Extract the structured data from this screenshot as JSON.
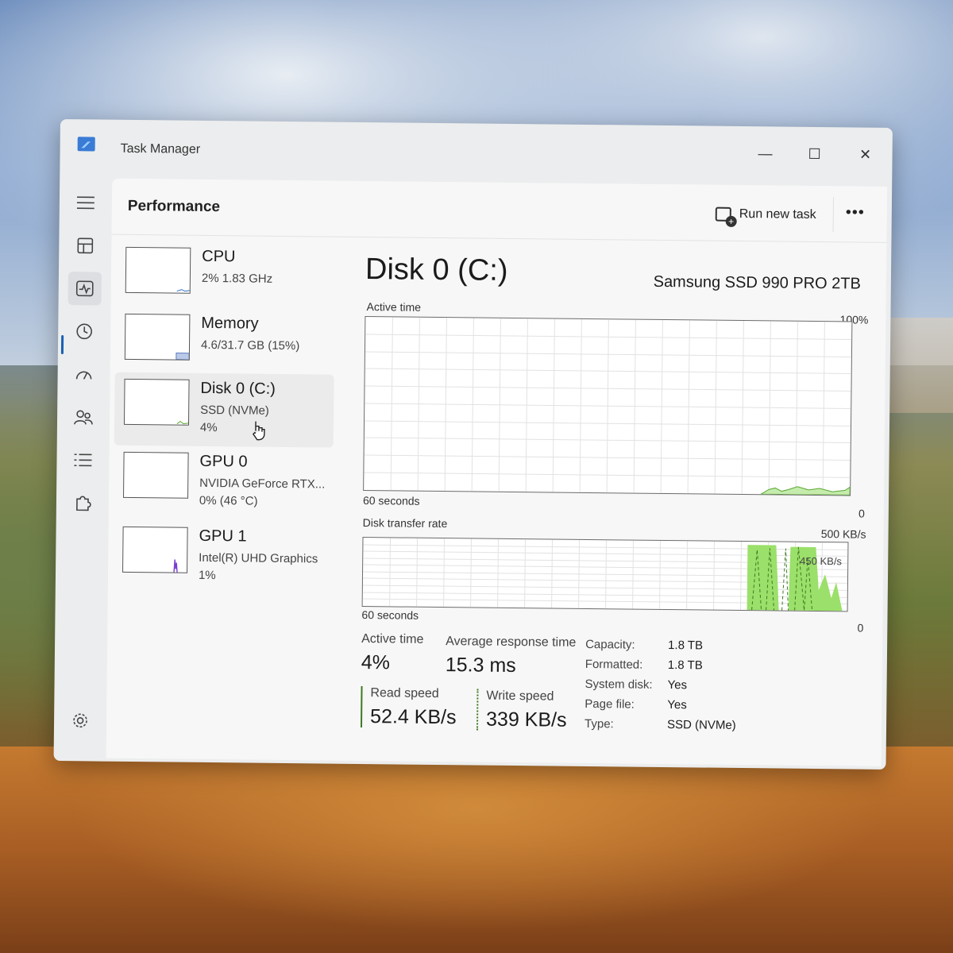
{
  "window": {
    "title": "Task Manager"
  },
  "window_controls": {
    "minimize": "—",
    "maximize": "☐",
    "close": "✕"
  },
  "nav": {
    "items": [
      {
        "name": "menu",
        "icon": "hamburger-menu-icon"
      },
      {
        "name": "processes",
        "icon": "processes-icon"
      },
      {
        "name": "performance",
        "icon": "performance-icon",
        "active": true
      },
      {
        "name": "app-history",
        "icon": "history-icon"
      },
      {
        "name": "startup-apps",
        "icon": "speedometer-icon"
      },
      {
        "name": "users",
        "icon": "users-icon"
      },
      {
        "name": "details",
        "icon": "list-icon"
      },
      {
        "name": "services",
        "icon": "puzzle-icon"
      }
    ],
    "settings_icon": "gear-icon"
  },
  "header": {
    "title": "Performance",
    "run_new_task": "Run new task",
    "more": "•••"
  },
  "devices": [
    {
      "name": "CPU",
      "line1": "2%  1.83 GHz",
      "line2": ""
    },
    {
      "name": "Memory",
      "line1": "4.6/31.7 GB (15%)",
      "line2": ""
    },
    {
      "name": "Disk 0 (C:)",
      "line1": "SSD (NVMe)",
      "line2": "4%",
      "active": true
    },
    {
      "name": "GPU 0",
      "line1": "NVIDIA GeForce RTX...",
      "line2": "0%  (46 °C)"
    },
    {
      "name": "GPU 1",
      "line1": "Intel(R) UHD Graphics",
      "line2": "1%"
    }
  ],
  "disk": {
    "title": "Disk 0 (C:)",
    "model": "Samsung SSD 990 PRO 2TB",
    "active_graph": {
      "label": "Active time",
      "max_label": "100%",
      "time_label": "60 seconds",
      "min_label": "0"
    },
    "transfer_graph": {
      "label": "Disk transfer rate",
      "max_label": "500 KB/s",
      "mid_label": "450 KB/s",
      "time_label": "60 seconds",
      "min_label": "0"
    },
    "stats": {
      "active_time_label": "Active time",
      "active_time_value": "4%",
      "avg_response_label": "Average response time",
      "avg_response_value": "15.3 ms",
      "read_label": "Read speed",
      "read_value": "52.4 KB/s",
      "write_label": "Write speed",
      "write_value": "339 KB/s"
    },
    "properties": [
      {
        "key": "Capacity:",
        "value": "1.8 TB"
      },
      {
        "key": "Formatted:",
        "value": "1.8 TB"
      },
      {
        "key": "System disk:",
        "value": "Yes"
      },
      {
        "key": "Page file:",
        "value": "Yes"
      },
      {
        "key": "Type:",
        "value": "SSD (NVMe)"
      }
    ]
  },
  "colors": {
    "graph_fill": "#9be06a",
    "graph_line": "#5aa832",
    "gpu1_line": "#7a3fd0",
    "accent": "#1a5fb4"
  }
}
